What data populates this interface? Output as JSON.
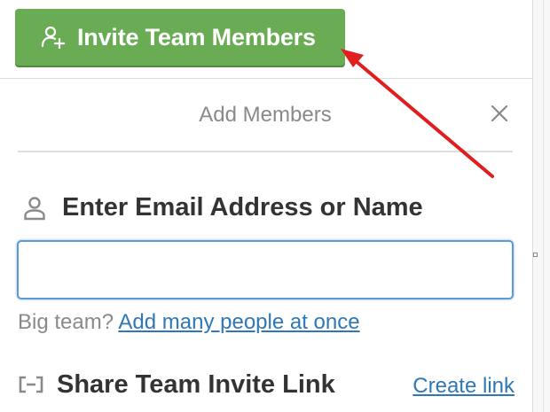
{
  "header": {
    "invite_button_label": "Invite Team Members",
    "invite_icon": "add-user-icon"
  },
  "dialog": {
    "title": "Add Members",
    "close_icon": "close-icon",
    "email_field": {
      "label": "Enter Email Address or Name",
      "icon": "person-icon",
      "value": "",
      "placeholder": ""
    },
    "big_team": {
      "prefix": "Big team?",
      "link_label": "Add many people at once"
    },
    "share": {
      "label": "Share Team Invite Link",
      "icon": "link-icon",
      "create_link_label": "Create link"
    }
  },
  "colors": {
    "invite_button": "#6aac54",
    "link": "#2f78b6",
    "input_focus_border": "#5b9ad3",
    "annotation_arrow": "#e01e1e"
  },
  "annotation": {
    "type": "arrow",
    "points_to": "invite-team-members-button"
  }
}
